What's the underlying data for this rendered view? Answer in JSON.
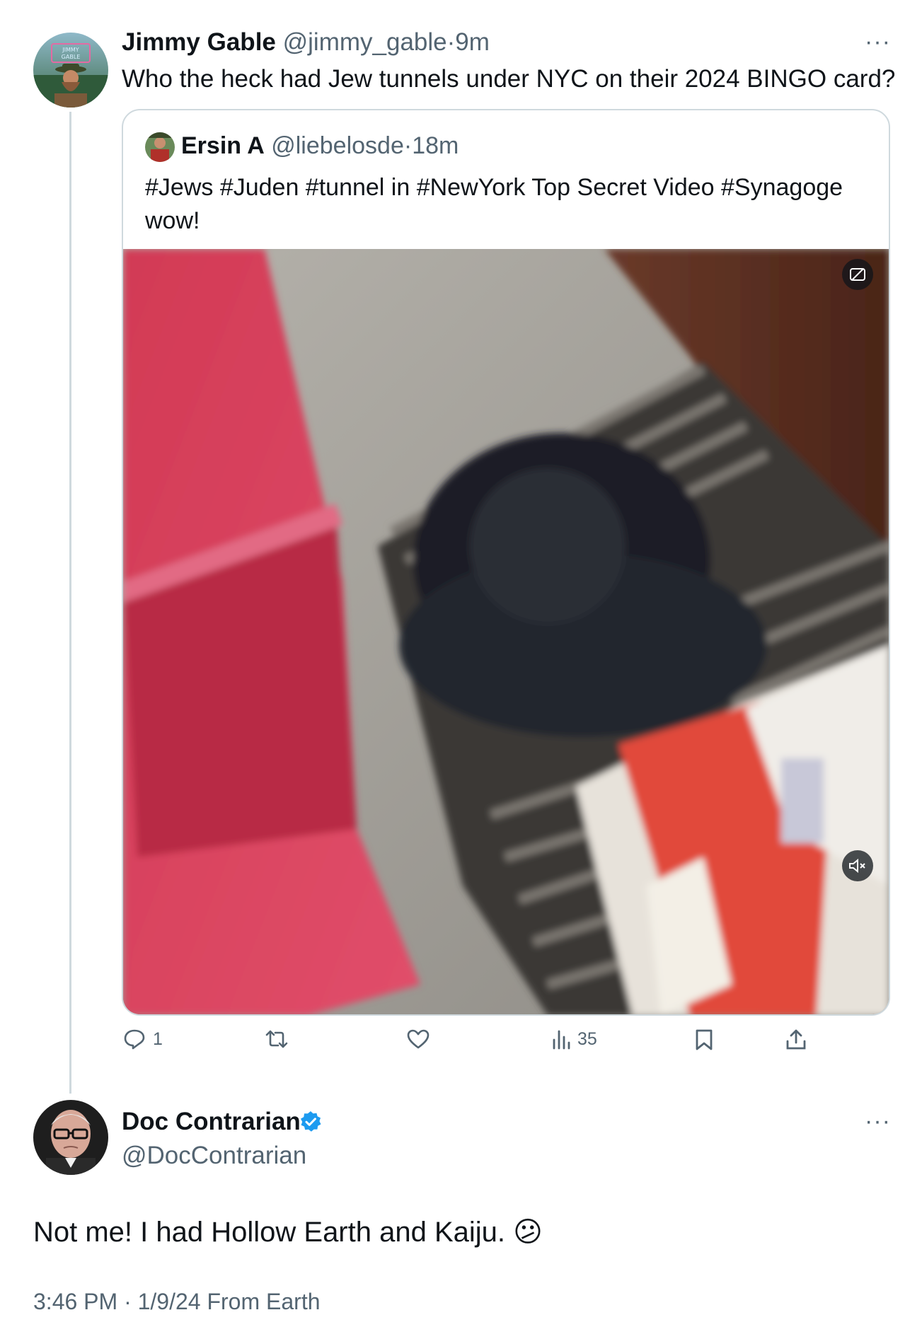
{
  "parent": {
    "author_name": "Jimmy Gable",
    "handle": "@jimmy_gable",
    "separator": "·",
    "time": "9m",
    "text": "Who the heck had Jew tunnels under NYC on their 2024 BINGO card?",
    "avatar_text": "JIMMY GABLE",
    "more_label": "···"
  },
  "quote": {
    "author_name": "Ersin A",
    "handle": "@liebelosde",
    "separator": "·",
    "time": "18m",
    "text_line1": "#Jews #Juden #tunnel in #NewYork Top Secret Video #Synagoge",
    "text_line2": "wow!",
    "video_icon_captions": "captions-icon",
    "video_icon_mute": "mute-icon"
  },
  "actions": {
    "reply_count": "1",
    "repost_count": "",
    "like_count": "",
    "views_count": "35"
  },
  "reply": {
    "author_name": "Doc Contrarian",
    "handle": "@DocContrarian",
    "text": "Not me! I had Hollow Earth and Kaiju. 😕",
    "timestamp": "3:46 PM · 1/9/24 From Earth",
    "more_label": "···",
    "verified_color": "#1d9bf0"
  },
  "colors": {
    "text": "#0f1419",
    "muted": "#536471",
    "border": "#cfd9de",
    "accent": "#1d9bf0"
  }
}
